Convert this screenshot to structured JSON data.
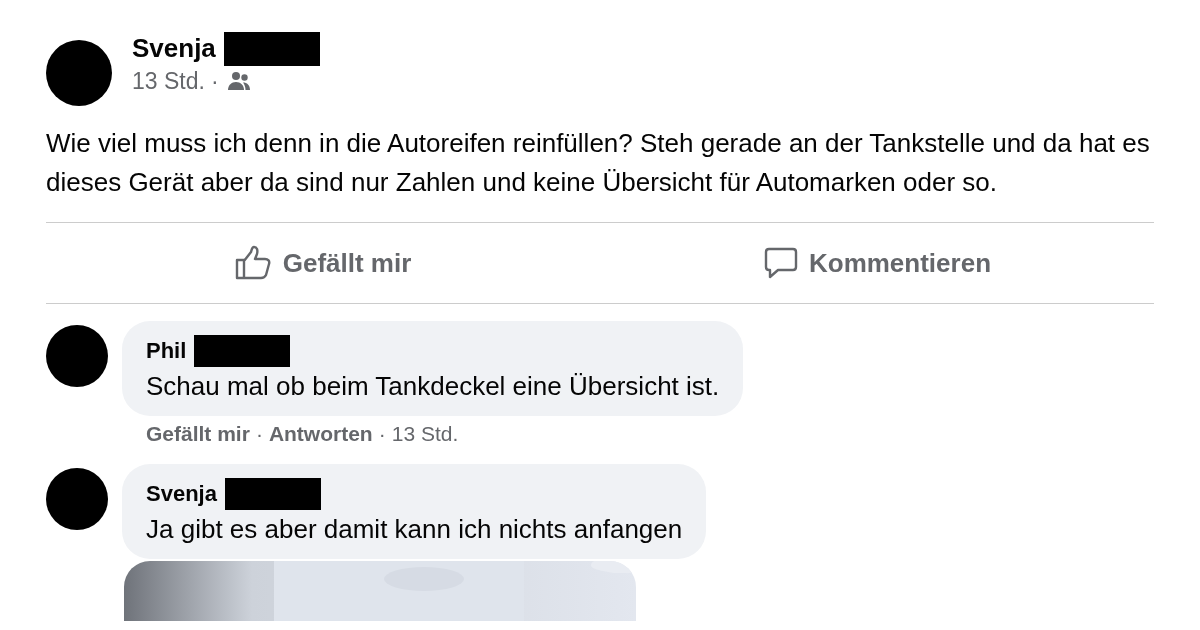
{
  "post": {
    "author": "Svenja",
    "time": "13 Std.",
    "separator": "·",
    "text": "Wie viel muss ich denn in die Autoreifen reinfüllen? Steh gerade an der Tankstelle und da hat es dieses Gerät aber da sind nur Zahlen und keine Übersicht für Automarken oder so."
  },
  "actions": [
    {
      "kind": "like",
      "label": "Gefällt mir"
    },
    {
      "kind": "comment",
      "label": "Kommentieren"
    }
  ],
  "comments": [
    {
      "author": "Phil",
      "text": "Schau mal ob beim Tankdeckel eine Übersicht ist.",
      "actions": [
        "Gefällt mir",
        "Antworten"
      ],
      "separator": "·",
      "time": "13 Std."
    },
    {
      "author": "Svenja",
      "text": "Ja gibt es aber damit kann ich nichts anfangen"
    }
  ]
}
